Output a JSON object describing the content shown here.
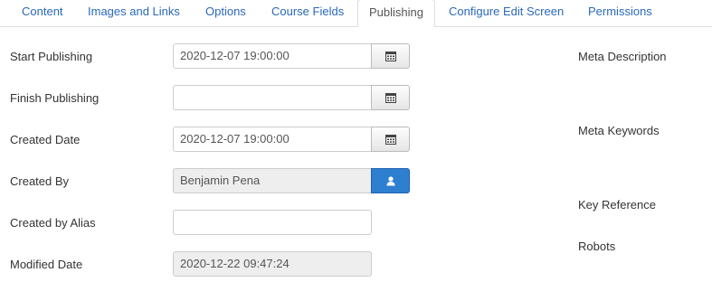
{
  "tabs": [
    {
      "label": "Content"
    },
    {
      "label": "Images and Links"
    },
    {
      "label": "Options"
    },
    {
      "label": "Course Fields"
    },
    {
      "label": "Publishing"
    },
    {
      "label": "Configure Edit Screen"
    },
    {
      "label": "Permissions"
    }
  ],
  "active_tab": "Publishing",
  "fields": {
    "start_publishing": {
      "label": "Start Publishing",
      "value": "2020-12-07 19:00:00"
    },
    "finish_publishing": {
      "label": "Finish Publishing",
      "value": ""
    },
    "created_date": {
      "label": "Created Date",
      "value": "2020-12-07 19:00:00"
    },
    "created_by": {
      "label": "Created By",
      "value": "Benjamin Pena"
    },
    "created_by_alias": {
      "label": "Created by Alias",
      "value": ""
    },
    "modified_date": {
      "label": "Modified Date",
      "value": "2020-12-22 09:47:24"
    }
  },
  "meta": {
    "meta_description": "Meta Description",
    "meta_keywords": "Meta Keywords",
    "key_reference": "Key Reference",
    "robots": "Robots"
  },
  "icons": {
    "calendar": "calendar-icon",
    "user": "user-icon"
  },
  "colors": {
    "link": "#2a69b8",
    "user_button": "#2f7fd0",
    "readonly_bg": "#eeeeee"
  }
}
